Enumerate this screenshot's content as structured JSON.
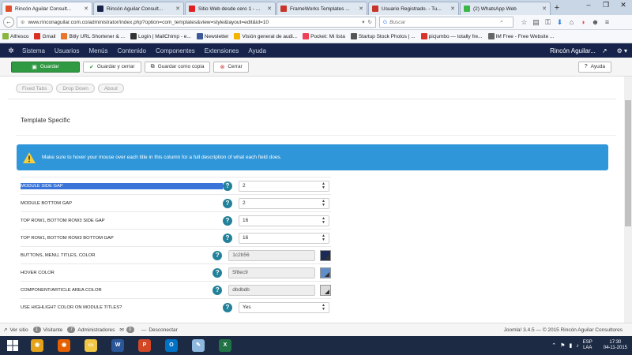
{
  "browser": {
    "tabs": [
      {
        "title": "Rincón Aguilar Consult...",
        "color": "#e14f2c"
      },
      {
        "title": "Rincón Aguilar Consult...",
        "color": "#17234b"
      },
      {
        "title": "Sitio Web desde cero 1 - ...",
        "color": "#e11f1f"
      },
      {
        "title": "FrameWorks Templates ...",
        "color": "#c8342a"
      },
      {
        "title": "Usuario Registrado. - Tu...",
        "color": "#c8342a"
      },
      {
        "title": "(2) WhatsApp Web",
        "color": "#3cb649"
      }
    ],
    "url": "www.rinconaguilar.com.co/administrator/index.php?option=com_templates&view=style&layout=edit&id=10",
    "search_placeholder": "Buscar",
    "bookmarks": [
      {
        "label": "Alfresco",
        "color": "#8ab640"
      },
      {
        "label": "Gmail",
        "color": "#d93025"
      },
      {
        "label": "Bitly URL Shortener & ...",
        "color": "#e8752b"
      },
      {
        "label": "Login | MailChimp - e...",
        "color": "#333333"
      },
      {
        "label": "Newsletter",
        "color": "#3b5998"
      },
      {
        "label": "Visión general de audi...",
        "color": "#f4b400"
      },
      {
        "label": "Pocket: Mi lista",
        "color": "#ee4056"
      },
      {
        "label": "Startup Stock Photos | ...",
        "color": "#555555"
      },
      {
        "label": "picjumbo — totally fre...",
        "color": "#d9322a"
      },
      {
        "label": "IM Free - Free Website ...",
        "color": "#666666"
      }
    ]
  },
  "joomla": {
    "menu": [
      "Sistema",
      "Usuarios",
      "Menús",
      "Contenido",
      "Componentes",
      "Extensiones",
      "Ayuda"
    ],
    "site_name": "Rincón Aguilar...",
    "actions": {
      "save": "Guardar",
      "save_close": "Guardar y cerrar",
      "save_copy": "Guardar como copia",
      "close": "Cerrar",
      "help": "Ayuda"
    },
    "subtabs": [
      "Fixed Tabs",
      "Drop Down",
      "About"
    ],
    "section_title": "Template Specific",
    "alert": "Make sure to hover your mouse over each title in this column for a full description of what each field does.",
    "fields": [
      {
        "label": "MODULE SIDE GAP",
        "value": "2",
        "type": "select"
      },
      {
        "label": "MODULE BOTTOM GAP",
        "value": "2",
        "type": "select"
      },
      {
        "label": "TOP ROW1, BOTTOM ROW3 SIDE GAP",
        "value": "16",
        "type": "select"
      },
      {
        "label": "TOP ROW1, BOTTOM ROW3 BOTTOM GAP",
        "value": "16",
        "type": "select"
      },
      {
        "label": "BUTTONS, MENU, TITLES, COLOR",
        "value": "1c2b56",
        "type": "color",
        "swatch": "#1c2b56"
      },
      {
        "label": "HOVER COLOR",
        "value": "5f8ec9",
        "type": "color",
        "swatch": "#5f8ec9"
      },
      {
        "label": "COMPONENT/ARTICLE AREA COLOR",
        "value": "dbdbdb",
        "type": "color",
        "swatch": "#dbdbdb"
      },
      {
        "label": "USE HIGHLIGHT COLOR ON MODULE TITLES?",
        "value": "Yes",
        "type": "select"
      }
    ],
    "status": {
      "view_site": "Ver sitio",
      "visitors_count": "1",
      "visitors": "Visitante",
      "admins_count": "7",
      "admins": "Administradores",
      "messages_count": "0",
      "logout": "Desconectar",
      "footer": "Joomla! 3.4.5 — © 2015 Rincón Aguilar Consultores"
    }
  },
  "taskbar": {
    "apps": [
      {
        "name": "chrome",
        "color": "#e5a21b",
        "label": "◉"
      },
      {
        "name": "firefox",
        "color": "#e66000",
        "label": "◉"
      },
      {
        "name": "explorer",
        "color": "#f2c744",
        "label": "▭"
      },
      {
        "name": "word",
        "color": "#2b579a",
        "label": "W"
      },
      {
        "name": "powerpoint",
        "color": "#d24726",
        "label": "P"
      },
      {
        "name": "outlook",
        "color": "#0072c6",
        "label": "O"
      },
      {
        "name": "paint",
        "color": "#8fb8de",
        "label": "✎"
      },
      {
        "name": "excel",
        "color": "#217346",
        "label": "X"
      }
    ],
    "lang_top": "ESP",
    "lang_bottom": "LAA",
    "time": "17:30",
    "date": "04-11-2015"
  }
}
